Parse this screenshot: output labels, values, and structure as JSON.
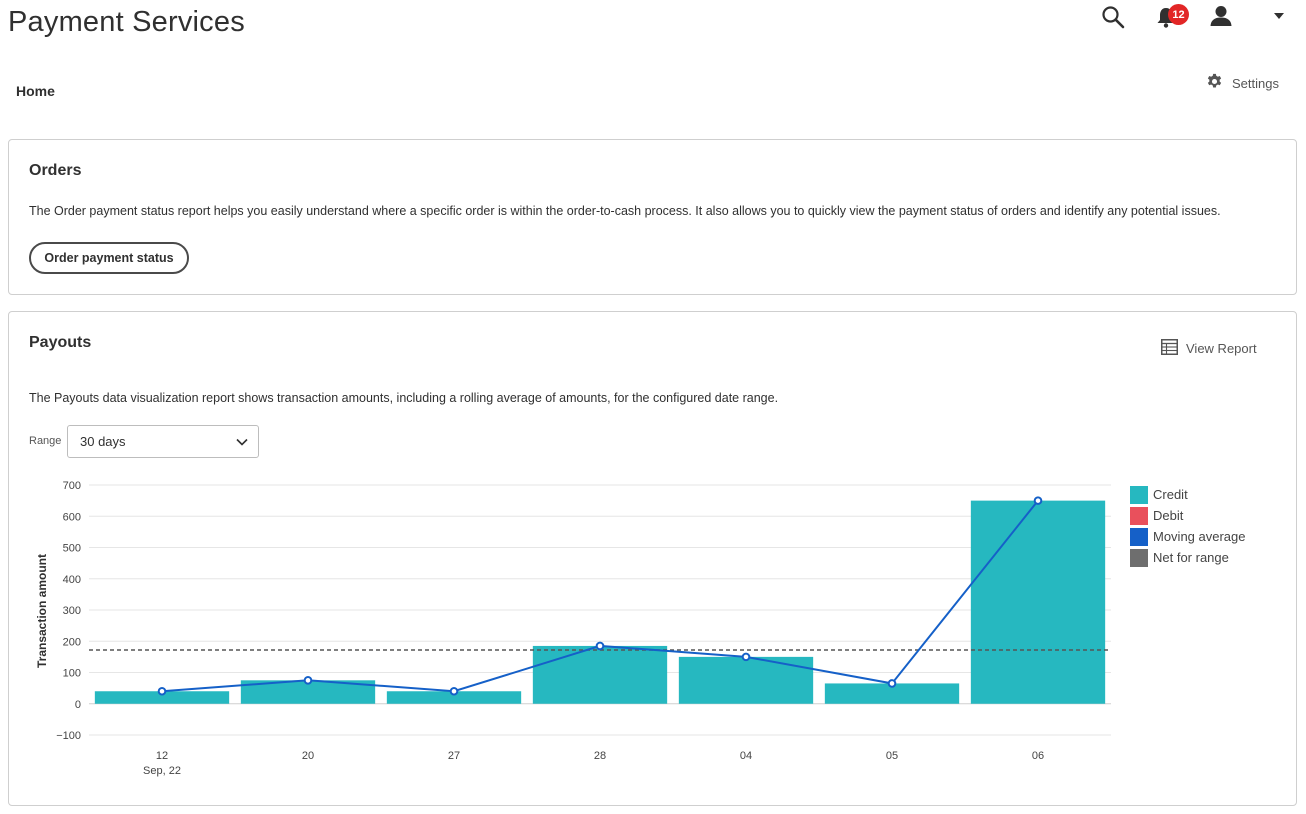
{
  "header": {
    "title": "Payment Services",
    "notification_count": "12"
  },
  "breadcrumb": "Home",
  "settings_label": "Settings",
  "orders": {
    "title": "Orders",
    "description": "The Order payment status report helps you easily understand where a specific order is within the order-to-cash process. It also allows you to quickly view the payment status of orders and identify any potential issues.",
    "button_label": "Order payment status"
  },
  "payouts": {
    "title": "Payouts",
    "view_report_label": "View Report",
    "description": "The Payouts data visualization report shows transaction amounts, including a rolling average of amounts, for the configured date range.",
    "range_label": "Range",
    "range_value": "30 days"
  },
  "colors": {
    "credit": "#26b8c0",
    "debit": "#e9505c",
    "moving_average": "#1560c8",
    "net_for_range": "#6e6e6e",
    "badge": "#e22626"
  },
  "chart_data": {
    "type": "bar",
    "categories": [
      "12",
      "20",
      "27",
      "28",
      "04",
      "05",
      "06"
    ],
    "category_sublabels": [
      "Sep, 22",
      "",
      "",
      "",
      "",
      "",
      ""
    ],
    "series": [
      {
        "name": "Credit",
        "values": [
          40,
          75,
          40,
          185,
          150,
          65,
          650
        ]
      },
      {
        "name": "Debit",
        "values": [
          0,
          0,
          0,
          0,
          0,
          0,
          0
        ]
      },
      {
        "name": "Moving average",
        "type": "line",
        "values": [
          40,
          75,
          40,
          185,
          150,
          65,
          650
        ]
      }
    ],
    "net_for_range": 172,
    "ylabel": "Transaction amount",
    "ylim": [
      -100,
      700
    ],
    "yticks": [
      -100,
      0,
      100,
      200,
      300,
      400,
      500,
      600,
      700
    ],
    "ytick_labels": [
      "−100",
      "0",
      "100",
      "200",
      "300",
      "400",
      "500",
      "600",
      "700"
    ],
    "grid": true,
    "legend": [
      "Credit",
      "Debit",
      "Moving average",
      "Net for range"
    ],
    "legend_position": "right"
  }
}
